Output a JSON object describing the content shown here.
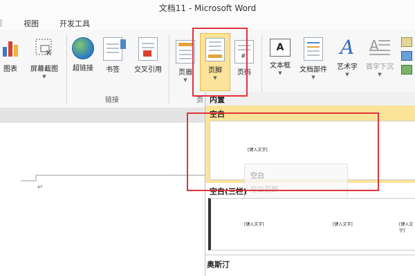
{
  "window": {
    "title": "文档11 - Microsoft Word"
  },
  "menu": {
    "tabs": [
      "视图",
      "开发工具"
    ]
  },
  "ribbon": {
    "chart_label": "图表",
    "screenshot_label": "屏幕截图",
    "hyperlink_label": "超链接",
    "bookmark_label": "书签",
    "crossref_label": "交叉引用",
    "links_group_label": "链接",
    "header_label": "页眉",
    "footer_label": "页脚",
    "pagenum_label": "页码",
    "textbox_label": "文本框",
    "docparts_label": "文档部件",
    "wordart_label": "艺术字",
    "dropcap_label": "首字下沉",
    "cut_group_char": "页"
  },
  "gallery": {
    "builtin_label": "内置",
    "items": [
      {
        "name": "空白",
        "placeholders": [
          "[键入文字]"
        ]
      },
      {
        "name": "空白(三栏)",
        "placeholders": [
          "[键入文字]",
          "[键入文字]",
          "[键入文字]"
        ]
      },
      {
        "name": "奥斯汀",
        "placeholders": []
      }
    ],
    "tooltip_title": "空白",
    "tooltip_desc": "空白页脚"
  },
  "colors": {
    "highlight": "#fbe39a",
    "annotation_red": "#e0333a",
    "accent_orange": "#e2a43a"
  }
}
